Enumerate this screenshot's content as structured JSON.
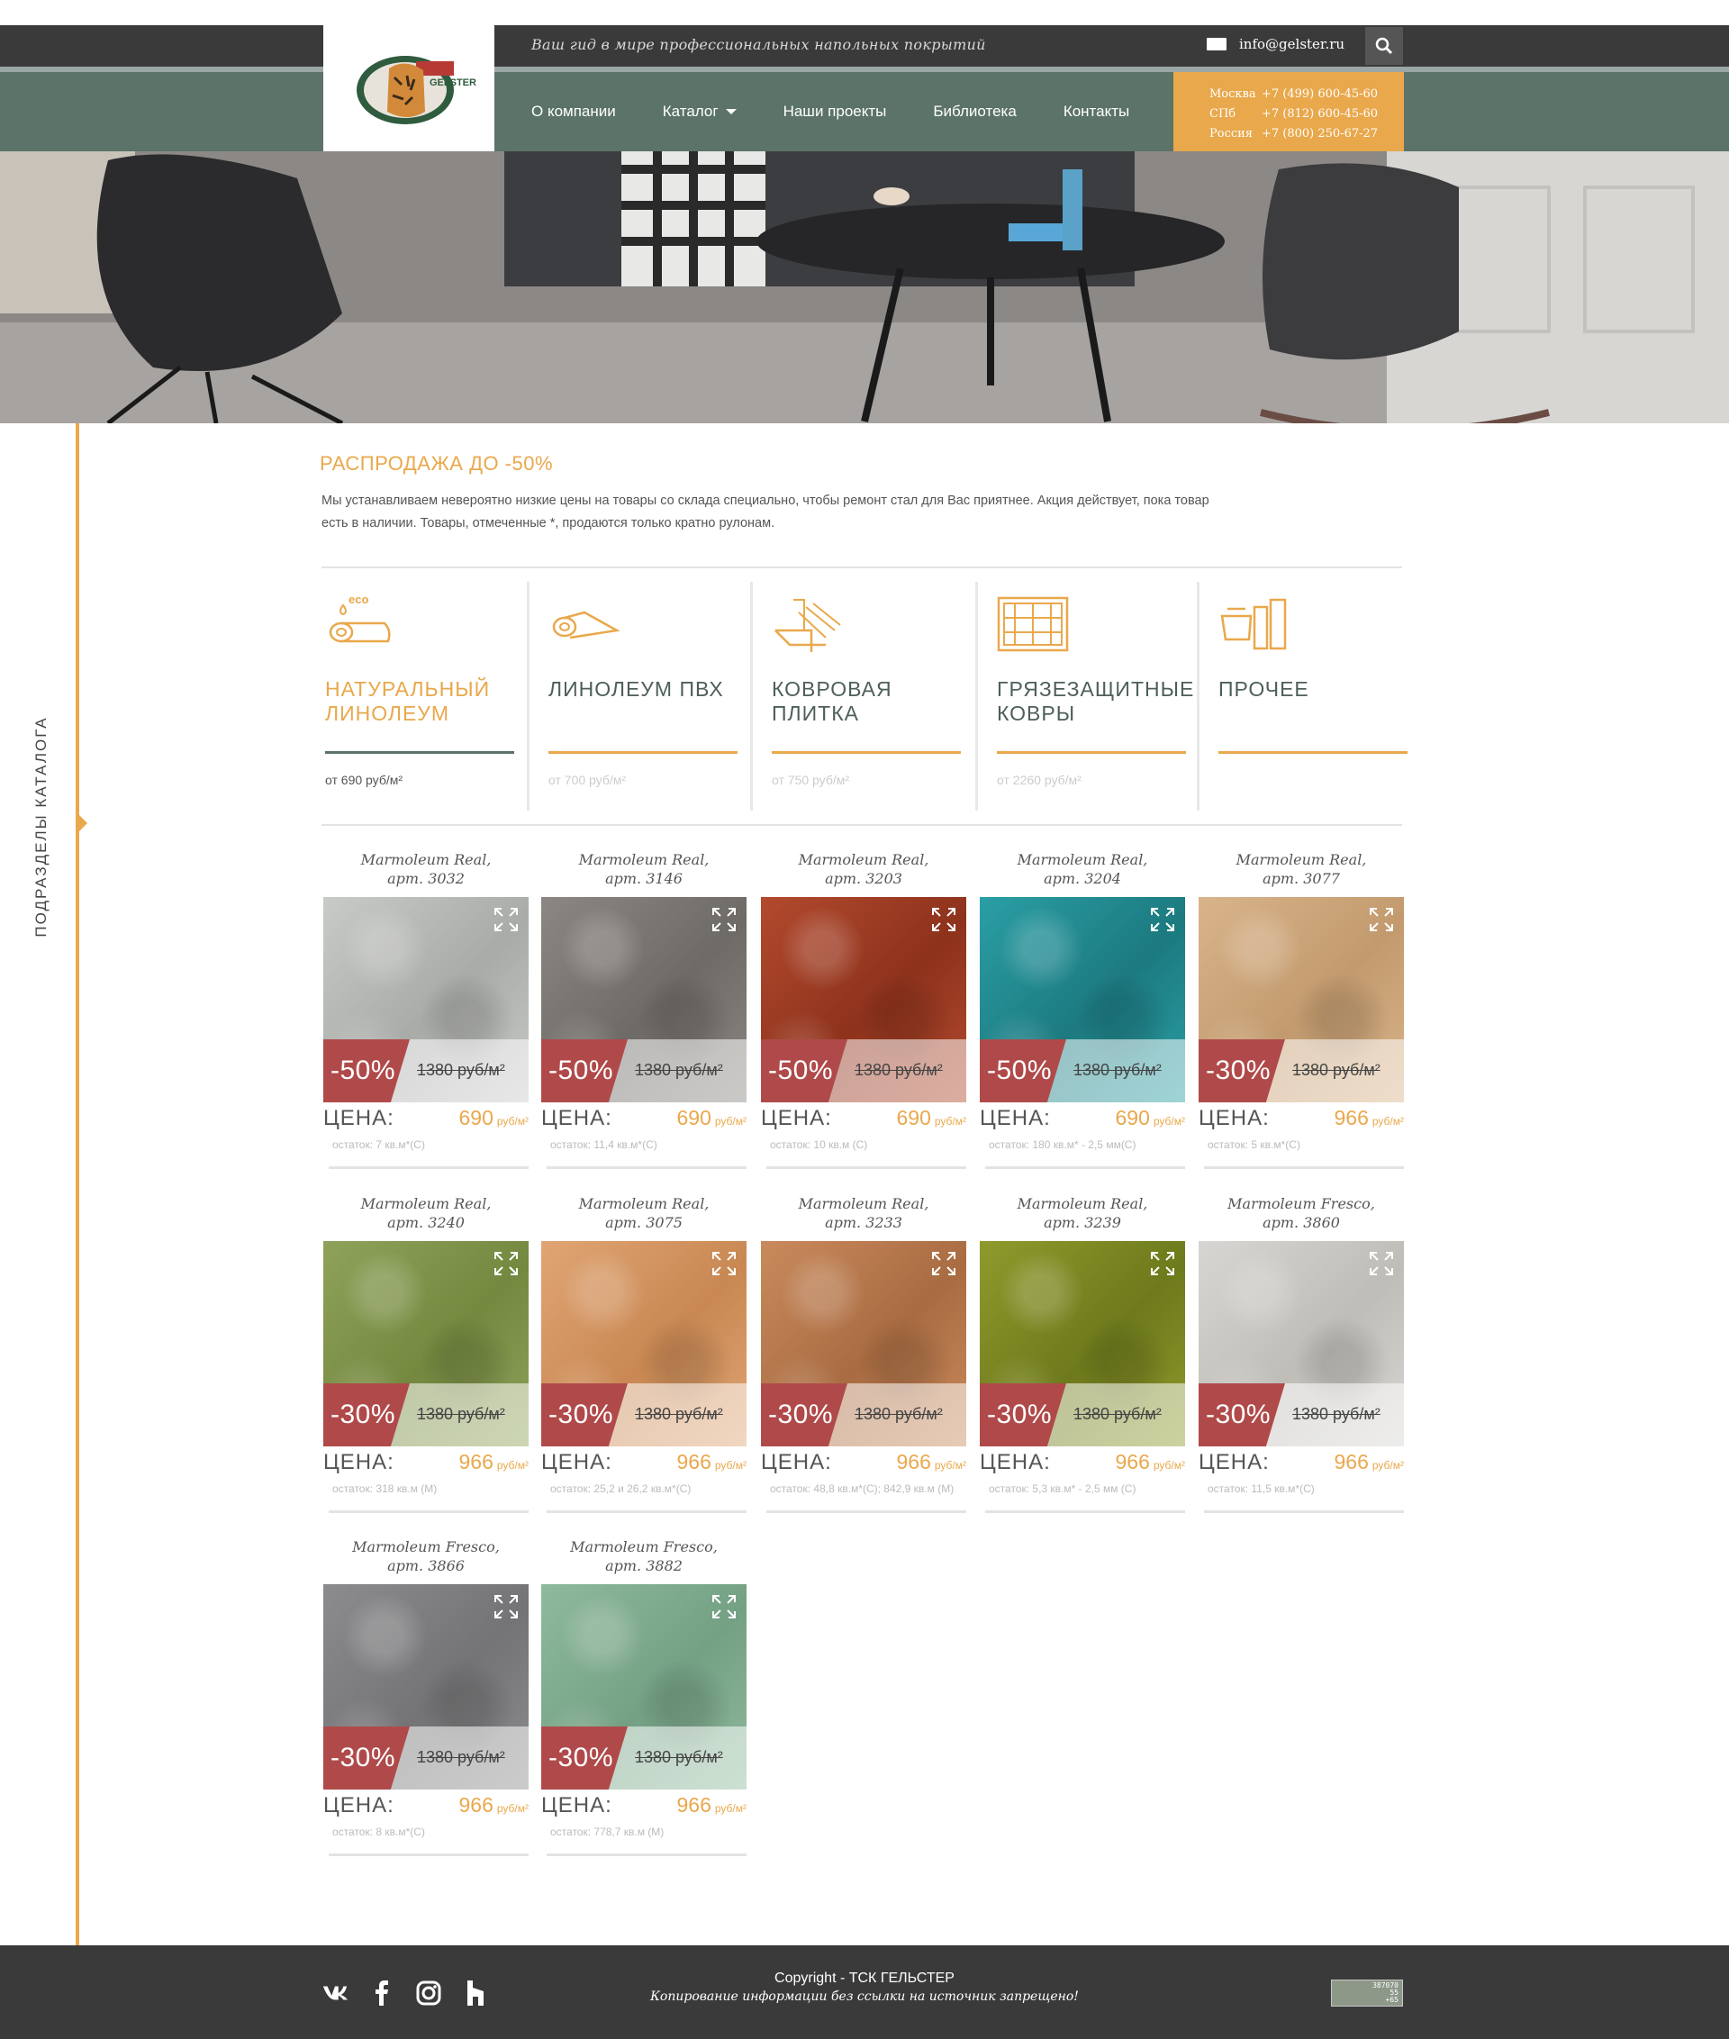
{
  "header": {
    "tagline": "Ваш гид в мире профессиональных напольных покрытий",
    "email": "info@gelster.ru",
    "logo_text": "GELSTER",
    "nav": [
      "О компании",
      "Каталог",
      "Наши проекты",
      "Библиотека",
      "Контакты"
    ],
    "phones": [
      {
        "city": "Москва",
        "number": "+7 (499) 600-45-60"
      },
      {
        "city": "СПб",
        "number": "+7 (812) 600-45-60"
      },
      {
        "city": "Россия",
        "number": "+7 (800) 250-67-27"
      }
    ]
  },
  "sidebar": {
    "label": "ПОДРАЗДЕЛЫ КАТАЛОГА"
  },
  "sale": {
    "title": "РАСПРОДАЖА ДО -50%",
    "text": "Мы устанавливаем невероятно низкие цены на товары со склада специально, чтобы ремонт стал для Вас приятнее.  Акция действует, пока товар есть в наличии. Товары, отмеченные *, продаются только кратно рулонам."
  },
  "categories": [
    {
      "name_1": "НАТУРАЛЬНЫЙ",
      "name_2": "ЛИНОЛЕУМ",
      "price": "от 690 руб/м²",
      "eco": "eco",
      "icon": "roll-eco-icon"
    },
    {
      "name_1": "ЛИНОЛЕУМ ПВХ",
      "name_2": "",
      "price": "от 700 руб/м²",
      "icon": "roll-icon"
    },
    {
      "name_1": "КОВРОВАЯ",
      "name_2": "ПЛИТКА",
      "price": "от 750 руб/м²",
      "icon": "carpet-tile-icon"
    },
    {
      "name_1": "ГРЯЗЕЗАЩИТНЫЕ",
      "name_2": "КОВРЫ",
      "price": "от 2260 руб/м²",
      "icon": "mat-icon"
    },
    {
      "name_1": "ПРОЧЕЕ",
      "name_2": "",
      "price": "",
      "icon": "other-icon"
    }
  ],
  "price_label": "ЦЕНА:",
  "unit": "руб/м²",
  "products": [
    {
      "name_1": "Marmoleum Real,",
      "name_2": "арт. 3032",
      "discount": "-50%",
      "old_price": "1380 руб/м²",
      "price": "690",
      "stock": "остаток: 7 кв.м*(С)",
      "color": "#c9cbc8",
      "color2": "#a9aba8",
      "badge": "#b04a4a"
    },
    {
      "name_1": "Marmoleum Real,",
      "name_2": "арт. 3146",
      "discount": "-50%",
      "old_price": "1380 руб/м²",
      "price": "690",
      "stock": "остаток: 11,4 кв.м*(С)",
      "color": "#8c8782",
      "color2": "#6e6a66",
      "badge": "#b04a4a"
    },
    {
      "name_1": "Marmoleum Real,",
      "name_2": "арт. 3203",
      "discount": "-50%",
      "old_price": "1380 руб/м²",
      "price": "690",
      "stock": "остаток: 10 кв.м (С)",
      "color": "#b24a2e",
      "color2": "#8e321c",
      "badge": "#b04a4a"
    },
    {
      "name_1": "Marmoleum Real,",
      "name_2": "арт. 3204",
      "discount": "-50%",
      "old_price": "1380 руб/м²",
      "price": "690",
      "stock": "остаток: 180 кв.м* - 2,5 мм(С)",
      "color": "#2a9fa5",
      "color2": "#1c7a80",
      "badge": "#b04a4a"
    },
    {
      "name_1": "Marmoleum Real,",
      "name_2": "арт. 3077",
      "discount": "-30%",
      "old_price": "1380 руб/м²",
      "price": "966",
      "stock": "остаток: 5 кв.м*(С)",
      "color": "#d9b48a",
      "color2": "#c29a6e",
      "badge": "#b04a4a"
    },
    {
      "name_1": "Marmoleum Real,",
      "name_2": "арт. 3240",
      "discount": "-30%",
      "old_price": "1380 руб/м²",
      "price": "966",
      "stock": "остаток: 318 кв.м (М)",
      "color": "#8fa25a",
      "color2": "#74883f",
      "badge": "#b04a4a"
    },
    {
      "name_1": "Marmoleum Real,",
      "name_2": "арт. 3075",
      "discount": "-30%",
      "old_price": "1380 руб/м²",
      "price": "966",
      "stock": "остаток: 25,2 и 26,2 кв.м*(С)",
      "color": "#e0a574",
      "color2": "#c98853",
      "badge": "#b04a4a"
    },
    {
      "name_1": "Marmoleum Real,",
      "name_2": "арт. 3233",
      "discount": "-30%",
      "old_price": "1380 руб/м²",
      "price": "966",
      "stock": "остаток: 48,8 кв.м*(С); 842,9 кв.м (М)",
      "color": "#c98a5c",
      "color2": "#a96c42",
      "badge": "#b04a4a"
    },
    {
      "name_1": "Marmoleum Real,",
      "name_2": "арт. 3239",
      "discount": "-30%",
      "old_price": "1380 руб/м²",
      "price": "966",
      "stock": "остаток: 5,3 кв.м* - 2,5 мм (С)",
      "color": "#8f9a2c",
      "color2": "#6e7a1c",
      "badge": "#b04a4a"
    },
    {
      "name_1": "Marmoleum Fresco,",
      "name_2": "арт. 3860",
      "discount": "-30%",
      "old_price": "1380 руб/м²",
      "price": "966",
      "stock": "остаток: 11,5 кв.м*(С)",
      "color": "#d8d6d2",
      "color2": "#bfbdb8",
      "badge": "#b04a4a"
    },
    {
      "name_1": "Marmoleum Fresco,",
      "name_2": "арт. 3866",
      "discount": "-30%",
      "old_price": "1380 руб/м²",
      "price": "966",
      "stock": "остаток: 8 кв.м*(С)",
      "color": "#8c8c8e",
      "color2": "#747476",
      "badge": "#b04a4a"
    },
    {
      "name_1": "Marmoleum Fresco,",
      "name_2": "арт. 3882",
      "discount": "-30%",
      "old_price": "1380 руб/м²",
      "price": "966",
      "stock": "остаток: 778,7 кв.м (М)",
      "color": "#8fba9c",
      "color2": "#74a084",
      "badge": "#b04a4a"
    }
  ],
  "footer": {
    "copyright": "Copyright - ТСК ГЕЛЬСТЕР",
    "note": "Копирование информации без ссылки на источник запрещено!",
    "counter_lines": [
      "387070",
      "55",
      "+65"
    ],
    "social": [
      "vk-icon",
      "facebook-icon",
      "instagram-icon",
      "houzz-icon"
    ]
  },
  "colors": {
    "accent": "#e9a84c",
    "green": "#5b7369",
    "dark": "#3a3a3a"
  }
}
